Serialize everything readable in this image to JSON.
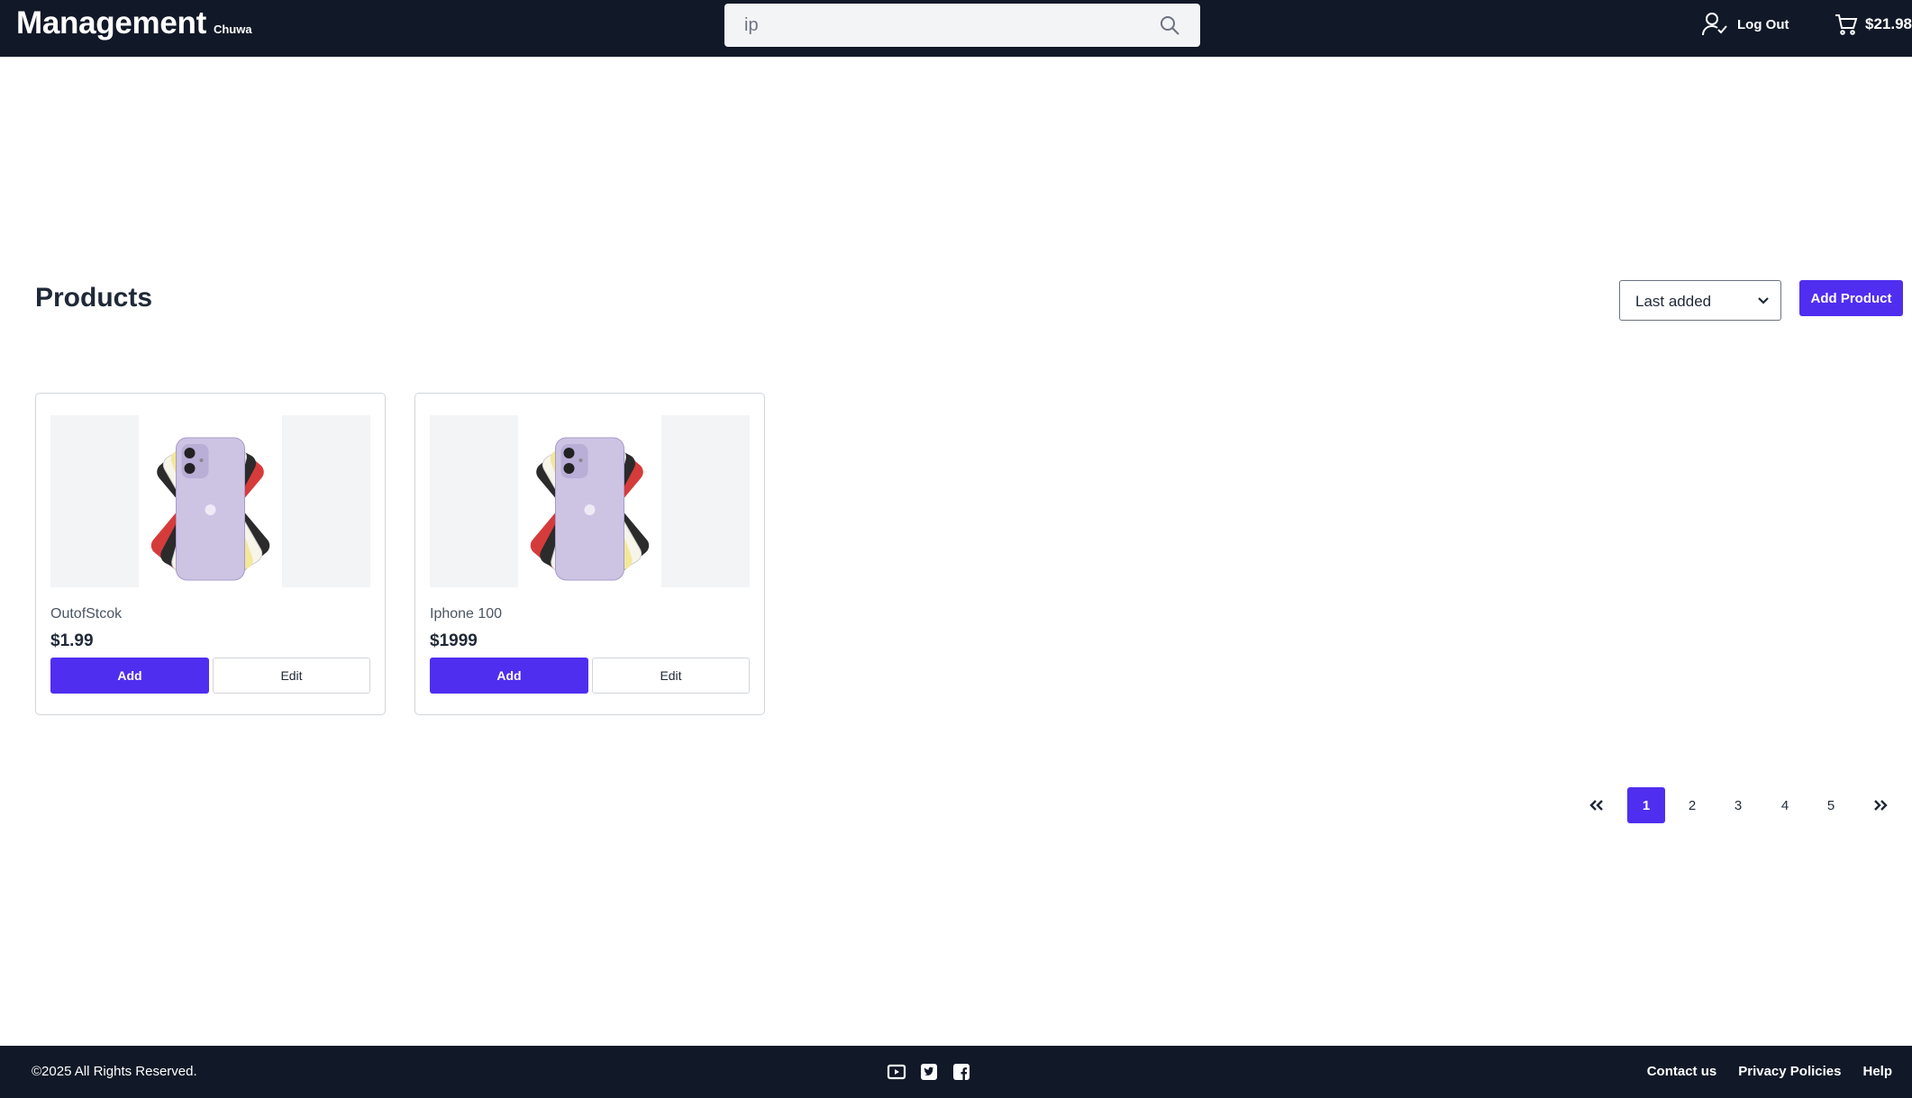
{
  "header": {
    "brand_title": "Management",
    "brand_subtitle": "Chuwa",
    "search": {
      "value": "ip",
      "icon": "search-icon"
    },
    "user_label": "Log Out",
    "cart_total": "$21.98"
  },
  "main": {
    "title": "Products",
    "sort": {
      "selected": "Last added"
    },
    "add_product_label": "Add Product",
    "products": [
      {
        "name": "OutofStcok",
        "price": "$1.99",
        "add_label": "Add",
        "edit_label": "Edit"
      },
      {
        "name": "Iphone 100",
        "price": "$1999",
        "add_label": "Add",
        "edit_label": "Edit"
      }
    ]
  },
  "pagination": {
    "first_icon": "chevrons-left-icon",
    "last_icon": "chevrons-right-icon",
    "pages": [
      "1",
      "2",
      "3",
      "4",
      "5"
    ],
    "active_page": "1"
  },
  "footer": {
    "copyright": "©2025 All Rights Reserved.",
    "social_icons": [
      "youtube-icon",
      "twitter-icon",
      "facebook-icon"
    ],
    "links": [
      "Contact us",
      "Privacy Policies",
      "Help"
    ]
  },
  "colors": {
    "header_bg": "#111827",
    "accent": "#4f2ef0"
  }
}
